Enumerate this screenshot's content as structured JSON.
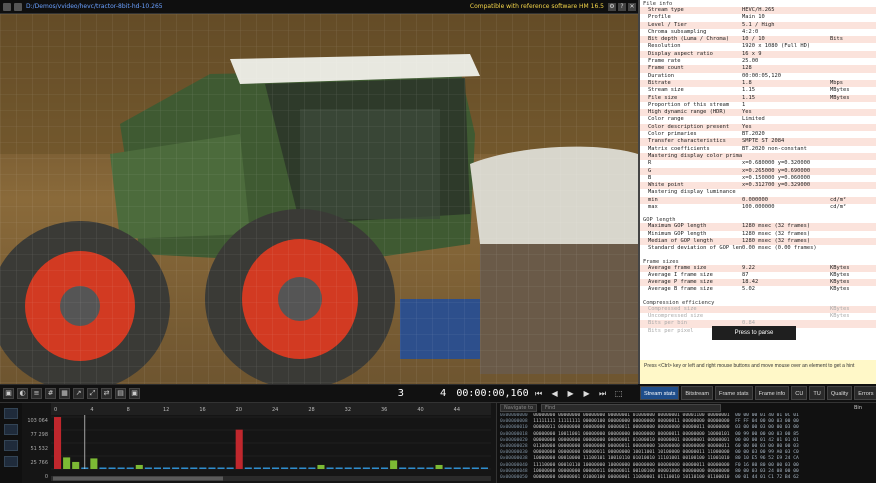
{
  "topbar": {
    "path": "D:/Demos/vvideo/hevc/tractor-8bit-hd-10.265",
    "compat": "Compatible with reference software HM 16.5"
  },
  "controls": {
    "frame_left": "3",
    "frame_right": "4",
    "timecode": "00:00:00,160"
  },
  "info": {
    "file_info_title": "File info",
    "rows": [
      {
        "k": "Stream type",
        "v": "HEVC/H.265",
        "u": ""
      },
      {
        "k": "Profile",
        "v": "Main 10",
        "u": ""
      },
      {
        "k": "Level / Tier",
        "v": "5.1 / High",
        "u": ""
      },
      {
        "k": "Chroma subsampling",
        "v": "4:2:0",
        "u": ""
      },
      {
        "k": "Bit depth (Luma / Chroma)",
        "v": "10 / 10",
        "u": "Bits"
      },
      {
        "k": "Resolution",
        "v": "1920 x 1080 (Full HD)",
        "u": ""
      },
      {
        "k": "Display aspect ratio",
        "v": "16 x 9",
        "u": ""
      },
      {
        "k": "Frame rate",
        "v": "25.00",
        "u": ""
      },
      {
        "k": "Frame count",
        "v": "128",
        "u": ""
      },
      {
        "k": "Duration",
        "v": "00:00:05,120",
        "u": ""
      },
      {
        "k": "Bitrate",
        "v": "1.8",
        "u": "Mbps"
      },
      {
        "k": "Stream size",
        "v": "1.15",
        "u": "MBytes"
      },
      {
        "k": "File size",
        "v": "1.15",
        "u": "MBytes"
      },
      {
        "k": "Proportion of this stream",
        "v": "1",
        "u": ""
      },
      {
        "k": "High dynamic range (HDR)",
        "v": "Yes",
        "u": ""
      },
      {
        "k": "Color range",
        "v": "Limited",
        "u": ""
      },
      {
        "k": "Color description present",
        "v": "Yes",
        "u": ""
      },
      {
        "k": "Color primaries",
        "v": "BT.2020",
        "u": ""
      },
      {
        "k": "Transfer characteristics",
        "v": "SMPTE ST 2084",
        "u": ""
      },
      {
        "k": "Matrix coefficients",
        "v": "BT.2020 non-constant",
        "u": ""
      },
      {
        "k": "Mastering display color primaries",
        "v": "",
        "u": ""
      },
      {
        "k": "   R",
        "v": "x=0.680000 y=0.320000",
        "u": ""
      },
      {
        "k": "   G",
        "v": "x=0.265000 y=0.690000",
        "u": ""
      },
      {
        "k": "   B",
        "v": "x=0.150000 y=0.060000",
        "u": ""
      },
      {
        "k": "   White point",
        "v": "x=0.312700 y=0.329000",
        "u": ""
      },
      {
        "k": "Mastering display luminance",
        "v": "",
        "u": ""
      },
      {
        "k": "   min",
        "v": "0.000000",
        "u": "cd/m²"
      },
      {
        "k": "   max",
        "v": "100.000000",
        "u": "cd/m²"
      }
    ],
    "gop_title": "GOP length",
    "gop_rows": [
      {
        "k": "Maximum GOP length",
        "v": "1280 msec (32 frames)",
        "u": ""
      },
      {
        "k": "Minimum GOP length",
        "v": "1280 msec (32 frames)",
        "u": ""
      },
      {
        "k": "Median of GOP length",
        "v": "1280 msec (32 frames)",
        "u": ""
      },
      {
        "k": "Standard deviation of GOP length",
        "v": "0.00 msec (0.00 frames)",
        "u": ""
      }
    ],
    "frame_sizes_title": "Frame sizes",
    "frame_rows": [
      {
        "k": "Average frame size",
        "v": "9.22",
        "u": "KBytes"
      },
      {
        "k": "Average I frame size",
        "v": "87",
        "u": "KBytes"
      },
      {
        "k": "Average P frame size",
        "v": "18.42",
        "u": "KBytes"
      },
      {
        "k": "Average B frame size",
        "v": "5.02",
        "u": "KBytes"
      }
    ],
    "compression_title": "Compression efficiency",
    "comp_rows": [
      {
        "k": "Compressed size",
        "v": "",
        "u": "KBytes"
      },
      {
        "k": "Uncompressed size",
        "v": "",
        "u": "KBytes"
      },
      {
        "k": "Bits per bin",
        "v": "0.84",
        "u": ""
      },
      {
        "k": "Bits per pixel",
        "v": "0.03",
        "u": ""
      }
    ]
  },
  "parse_button": "Press to parse",
  "hint": "Press <Ctrl> key or left and right mouse buttons and move mouse over an element to get a hint",
  "tabs": [
    "Stream stats",
    "Bitstream",
    "Frame stats",
    "Frame info",
    "CU",
    "TU",
    "Quality",
    "Errors"
  ],
  "graph": {
    "y_labels": [
      "103 064",
      "77 298",
      "51 532",
      "25 766",
      "0"
    ],
    "x_labels": [
      "0",
      "4",
      "8",
      "12",
      "16",
      "20",
      "24",
      "28",
      "32",
      "36",
      "40",
      "44"
    ]
  },
  "chart_data": {
    "type": "bar",
    "title": "",
    "xlabel": "",
    "ylabel": "",
    "ylim": [
      0,
      103064
    ],
    "categories": [
      0,
      1,
      2,
      3,
      4,
      5,
      6,
      7,
      8,
      9,
      10,
      11,
      12,
      13,
      14,
      15,
      16,
      17,
      18,
      19,
      20,
      21,
      22,
      23,
      24,
      25,
      26,
      27,
      28,
      29,
      30,
      31,
      32,
      33,
      34,
      35,
      36,
      37,
      38,
      39,
      40,
      41,
      42,
      43,
      44,
      45,
      46,
      47
    ],
    "values": [
      103000,
      23000,
      14000,
      3000,
      21000,
      3000,
      3000,
      3000,
      3000,
      8000,
      3000,
      3000,
      3000,
      3000,
      3000,
      3000,
      3000,
      3000,
      3000,
      3000,
      78000,
      3000,
      3000,
      3000,
      3000,
      3000,
      3000,
      3000,
      3000,
      8000,
      3000,
      3000,
      3000,
      3000,
      3000,
      3000,
      3000,
      17000,
      3000,
      3000,
      3000,
      3000,
      8000,
      3000,
      3000,
      3000,
      3000,
      3000
    ],
    "types": [
      "I",
      "P",
      "P",
      "B",
      "P",
      "B",
      "B",
      "B",
      "B",
      "P",
      "B",
      "B",
      "B",
      "B",
      "B",
      "B",
      "B",
      "B",
      "B",
      "B",
      "I",
      "B",
      "B",
      "B",
      "B",
      "B",
      "B",
      "B",
      "B",
      "P",
      "B",
      "B",
      "B",
      "B",
      "B",
      "B",
      "B",
      "P",
      "B",
      "B",
      "B",
      "B",
      "P",
      "B",
      "B",
      "B",
      "B",
      "B"
    ],
    "colors": {
      "I": "#c0272d",
      "P": "#7cba34",
      "B": "#2f8ecf"
    }
  },
  "hexpanel": {
    "nav_placeholder": "Navigate to",
    "find_placeholder": "Find",
    "bin_label": "Bin",
    "rows": [
      {
        "off": "0x00000000",
        "bits": "00000000 00000000 00000000 00000001 01000000 00000001 00001100 00000001",
        "hx": "00 00 00 01 40 01 0C 01"
      },
      {
        "off": "0x00000008",
        "bits": "11111111 11111111 00000100 00000000 00000000 00000011 00000000 00000000",
        "hx": "FF FF 04 00 00 03 00 00"
      },
      {
        "off": "0x00000010",
        "bits": "00000011 00000000 00000000 00000011 00000000 00000000 00000011 00000000",
        "hx": "03 00 00 03 00 00 03 00"
      },
      {
        "off": "0x00000018",
        "bits": "00000000 10011001 00000000 00000000 00000000 00000011 00000000 10000101",
        "hx": "00 99 00 00 00 03 00 85"
      },
      {
        "off": "0x00000020",
        "bits": "00000000 00000000 00000000 00000001 01000010 00000001 00000001 00000001",
        "hx": "00 00 00 01 42 01 01 01"
      },
      {
        "off": "0x00000028",
        "bits": "01100000 00000000 00000000 00000011 00000000 10000000 00000000 00000011",
        "hx": "60 00 00 03 00 80 00 03"
      },
      {
        "off": "0x00000030",
        "bits": "00000000 00000000 00000011 00000000 10011001 10100000 00000011 11000000",
        "hx": "00 00 03 00 99 A0 03 C0"
      },
      {
        "off": "0x00000038",
        "bits": "10000000 00010000 11100101 10010110 01010010 11101001 00100100 11001010",
        "hx": "80 10 E5 96 52 E9 24 CA"
      },
      {
        "off": "0x00000040",
        "bits": "11110000 00010110 10000000 10000000 00000000 00000000 00000011 00000000",
        "hx": "F0 16 80 80 00 00 03 00"
      },
      {
        "off": "0x00000048",
        "bits": "10000000 00000000 00000011 00000011 00100100 00001000 00000000 00000000",
        "hx": "80 00 03 03 24 08 00 00"
      },
      {
        "off": "0x00000050",
        "bits": "00000000 00000001 01000100 00000001 11000001 01110010 10110100 01100010",
        "hx": "00 01 44 01 C1 72 B4 62"
      }
    ]
  }
}
